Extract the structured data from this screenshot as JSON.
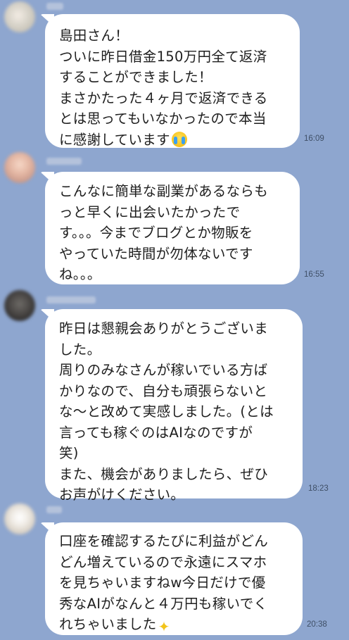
{
  "messages": [
    {
      "lines": [
        "島田さん！",
        "ついに昨日借金150万円全て返済",
        "することができました！",
        "まさかたった４ヶ月で返済できる",
        "とは思ってもいなかったので本当",
        "に感謝しています"
      ],
      "emoji": "loudly-crying-face",
      "time": "16:09"
    },
    {
      "lines": [
        "こんなに簡単な副業があるならも",
        "っと早くに出会いたかったで",
        "す。。。今までブログとか物販を",
        "やっていた時間が勿体ないです",
        "ね。。。"
      ],
      "time": "16:55"
    },
    {
      "lines": [
        "昨日は懇親会ありがとうございま",
        "した。",
        "周りのみなさんが稼いでいる方ば",
        "かりなので、自分も頑張らないと",
        "な〜と改めて実感しました。(とは",
        "言っても稼ぐのはAIなのですが",
        "笑)",
        "また、機会がありましたら、ぜひ",
        "お声がけください。"
      ],
      "time": "18:23"
    },
    {
      "lines": [
        "口座を確認するたびに利益がどん",
        "どん増えているので永遠にスマホ",
        "を見ちゃいますねw今日だけで優",
        "秀なAIがなんと４万円も稼いでく",
        "れちゃいました"
      ],
      "emoji": "sparkles",
      "time": "20:38"
    }
  ],
  "colors": {
    "background": "#8ea6cf",
    "bubble": "#ffffff",
    "text": "#1e1e1e",
    "timestamp": "#3f4f66"
  }
}
